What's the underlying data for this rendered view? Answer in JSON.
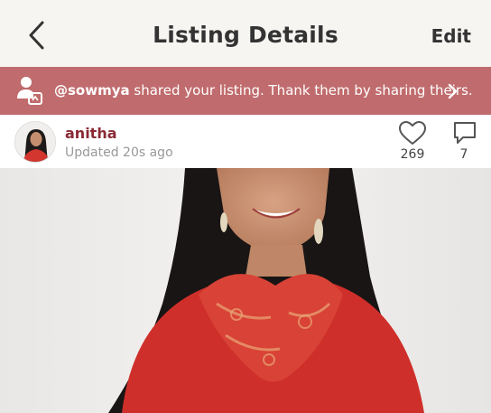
{
  "nav": {
    "title": "Listing Details",
    "edit_label": "Edit"
  },
  "banner": {
    "handle": "@sowmya",
    "message": " shared your listing. Thank them by sharing theirs.",
    "icon": "share-user-icon",
    "background": "#c06b6d"
  },
  "user": {
    "name": "anitha",
    "updated": "Updated 20s ago",
    "likes": "269",
    "comments": "7",
    "name_color": "#8b2a34"
  },
  "icons": {
    "back": "chevron-left-icon",
    "like": "heart-icon",
    "comment": "speech-bubble-icon",
    "banner_arrow": "chevron-right-icon"
  }
}
